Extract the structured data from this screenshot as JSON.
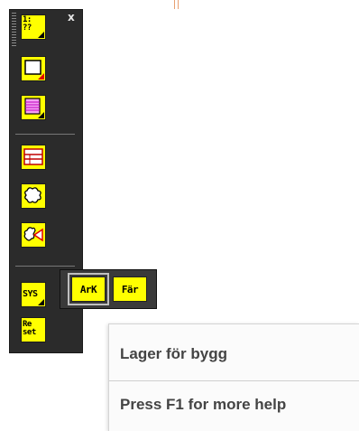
{
  "colors": {
    "toolbar_bg": "#2b2b2b",
    "button_yellow": "#ffff00",
    "tooltip_bg": "#fbfbfb",
    "tooltip_text": "#444444"
  },
  "toolbar": {
    "close_label": "x",
    "buttons": [
      {
        "id": "scale",
        "label": "1:\n??",
        "icon": "scale-icon",
        "has_flyout": true
      },
      {
        "id": "rectangle",
        "label": "",
        "icon": "rectangle-icon",
        "has_flyout": true
      },
      {
        "id": "hatch",
        "label": "",
        "icon": "hatch-fill-icon",
        "has_flyout": true
      },
      {
        "id": "table",
        "label": "",
        "icon": "table-icon",
        "has_flyout": false
      },
      {
        "id": "cloud",
        "label": "",
        "icon": "revision-cloud-icon",
        "has_flyout": false
      },
      {
        "id": "cloud-triangle",
        "label": "",
        "icon": "cloud-triangle-icon",
        "has_flyout": false
      },
      {
        "id": "sys",
        "label": "SYS",
        "icon": "sys-icon",
        "has_flyout": true
      },
      {
        "id": "reset",
        "label": "Re\nset",
        "icon": "reset-icon",
        "has_flyout": false
      }
    ]
  },
  "flyout": {
    "items": [
      {
        "label": "ArK",
        "active": true
      },
      {
        "label": "Fär",
        "active": false
      }
    ]
  },
  "tooltip": {
    "title": "Lager för bygg",
    "help": "Press F1 for more help"
  }
}
